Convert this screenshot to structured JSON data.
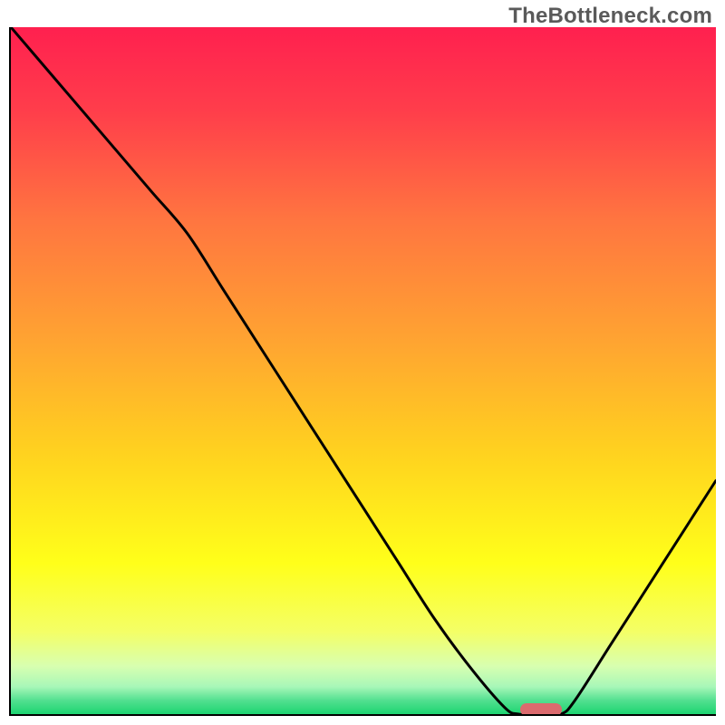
{
  "watermark": "TheBottleneck.com",
  "chart_data": {
    "type": "line",
    "title": "",
    "xlabel": "",
    "ylabel": "",
    "ylim": [
      0,
      100
    ],
    "x": [
      0,
      5,
      10,
      15,
      20,
      25,
      30,
      35,
      40,
      45,
      50,
      55,
      60,
      65,
      70,
      72,
      75,
      78,
      80,
      85,
      90,
      95,
      100
    ],
    "values": [
      100,
      94,
      88,
      82,
      76,
      70,
      62,
      54,
      46,
      38,
      30,
      22,
      14,
      7,
      1,
      0,
      0,
      0,
      2,
      10,
      18,
      26,
      34
    ],
    "marker": {
      "x_start": 72,
      "x_end": 78,
      "y": 0
    },
    "gradient_stops": [
      {
        "pct": 0,
        "color": "#ff204f"
      },
      {
        "pct": 12,
        "color": "#ff3d4b"
      },
      {
        "pct": 28,
        "color": "#ff7540"
      },
      {
        "pct": 45,
        "color": "#ffa232"
      },
      {
        "pct": 62,
        "color": "#ffd21f"
      },
      {
        "pct": 78,
        "color": "#ffff1a"
      },
      {
        "pct": 88,
        "color": "#f4ff66"
      },
      {
        "pct": 93,
        "color": "#d8ffb0"
      },
      {
        "pct": 96,
        "color": "#a8f7b8"
      },
      {
        "pct": 98,
        "color": "#52e090"
      },
      {
        "pct": 100,
        "color": "#1cd470"
      }
    ]
  }
}
